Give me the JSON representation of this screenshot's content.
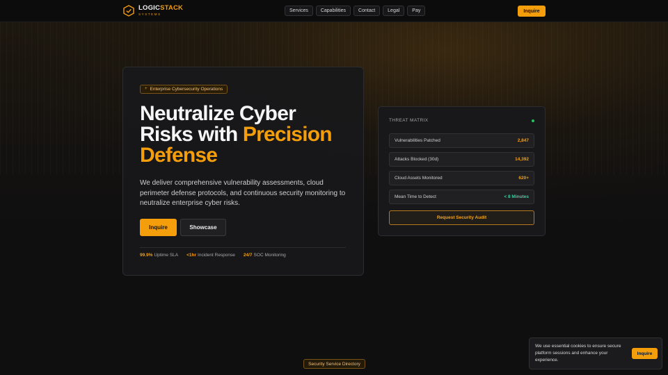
{
  "header": {
    "logo": {
      "name_part1": "LOGIC",
      "name_part2": "STACK",
      "sub": "SYSTEMS"
    },
    "nav": [
      "Services",
      "Capabilities",
      "Contact",
      "Legal",
      "Pay"
    ],
    "cta_label": "Inquire"
  },
  "hero": {
    "tag": "Enterprise Cybersecurity Operations",
    "headline_line1": "Neutralize Cyber",
    "headline_line2_plain": "Risks with ",
    "headline_line2_accent": "Precision",
    "headline_line3_accent": "Defense",
    "description": "We deliver comprehensive vulnerability assessments, cloud perimeter defense protocols, and continuous security monitoring to neutralize enterprise cyber risks.",
    "primary_button": "Inquire",
    "secondary_button": "Showcase",
    "stats": [
      {
        "value": "99.9%",
        "label": "Uptime SLA"
      },
      {
        "value": "<1hr",
        "label": "Incident Response"
      },
      {
        "value": "24/7",
        "label": "SOC Monitoring"
      }
    ]
  },
  "matrix": {
    "title": "THREAT MATRIX",
    "rows": [
      {
        "label": "Vulnerabilities Patched",
        "value": "2,847"
      },
      {
        "label": "Attacks Blocked (30d)",
        "value": "14,392"
      },
      {
        "label": "Cloud Assets Monitored",
        "value": "620+"
      },
      {
        "label": "Mean Time to Detect",
        "value": "< 8 Minutes"
      }
    ],
    "button": "Request Security Audit"
  },
  "directory_label": "Security Service Directory",
  "cookie": {
    "text": "We use essential cookies to ensure secure platform sessions and enhance your experience.",
    "button": "Inquire"
  },
  "colors": {
    "accent": "#f59e0b",
    "status_green": "#22c55e",
    "background": "#0f0f10"
  }
}
